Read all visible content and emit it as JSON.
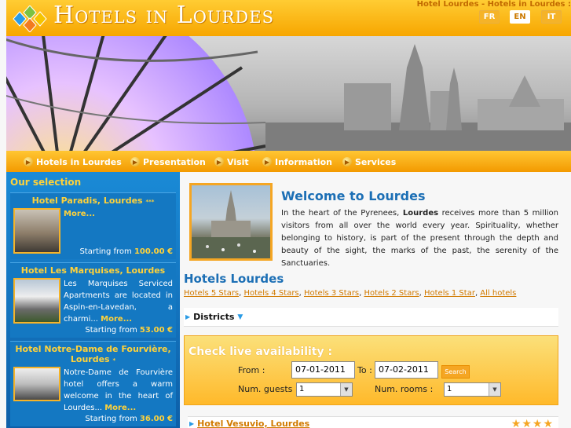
{
  "header": {
    "title": "Hotels in Lourdes",
    "tagline": "Hotel Lourdes - Hotels in Lourdes :",
    "languages": [
      "FR",
      "EN",
      "IT"
    ],
    "active_language": "EN"
  },
  "nav": {
    "items": [
      "Hotels in Lourdes",
      "Presentation",
      "Visit",
      "Information",
      "Services"
    ]
  },
  "sidebar": {
    "title": "Our selection",
    "hotels": [
      {
        "name": "Hotel Paradis, Lourdes",
        "stars": "***",
        "description": "",
        "more": "More...",
        "price_prefix": "Starting from",
        "price": "100.00 €"
      },
      {
        "name": "Hotel Les Marquises, Lourdes",
        "stars": "",
        "description": "Les Marquises Serviced Apartments are located in Aspin-en-Lavedan, a charmi...",
        "more": "More...",
        "price_prefix": "Starting from",
        "price": "53.00 €"
      },
      {
        "name": "Hotel Notre-Dame de Fourvière, Lourdes",
        "stars": "*",
        "description": "Notre-Dame de Fourvière hotel offers a warm welcome in the heart of Lourdes...",
        "more": "More...",
        "price_prefix": "Starting from",
        "price": "36.00 €"
      }
    ]
  },
  "welcome": {
    "title": "Welcome to Lourdes",
    "text_before": "In the heart of the Pyrenees, ",
    "text_bold": "Lourdes",
    "text_after": " receives more than 5 million visitors from all over the world every year. Spirituality, whether belonging to history, is part of the present through the depth and beauty of the sight, the marks of the past, the serenity of the Sanctuaries."
  },
  "hotels": {
    "title": "Hotels Lourdes",
    "links": [
      "Hotels 5 Stars",
      "Hotels 4 Stars",
      "Hotels 3 Stars",
      "Hotels 2 Stars",
      "Hotels 1 Star",
      "All hotels"
    ],
    "separator": ", "
  },
  "districts": {
    "label": "Districts"
  },
  "availability": {
    "title": "Check live availability :",
    "from_label": "From :",
    "from_value": "07-01-2011",
    "to_label": "To :",
    "to_value": "07-02-2011",
    "search_label": "Search",
    "guests_label": "Num. guests :",
    "guests_value": "1",
    "rooms_label": "Num. rooms :",
    "rooms_value": "1"
  },
  "listing": {
    "name": "Hotel Vesuvio, Lourdes",
    "stars": "★★★★"
  },
  "colors": {
    "orange": "#f5a623",
    "blue": "#1478c2",
    "title_blue": "#1c6fb5",
    "yellow": "#ffd23a"
  }
}
